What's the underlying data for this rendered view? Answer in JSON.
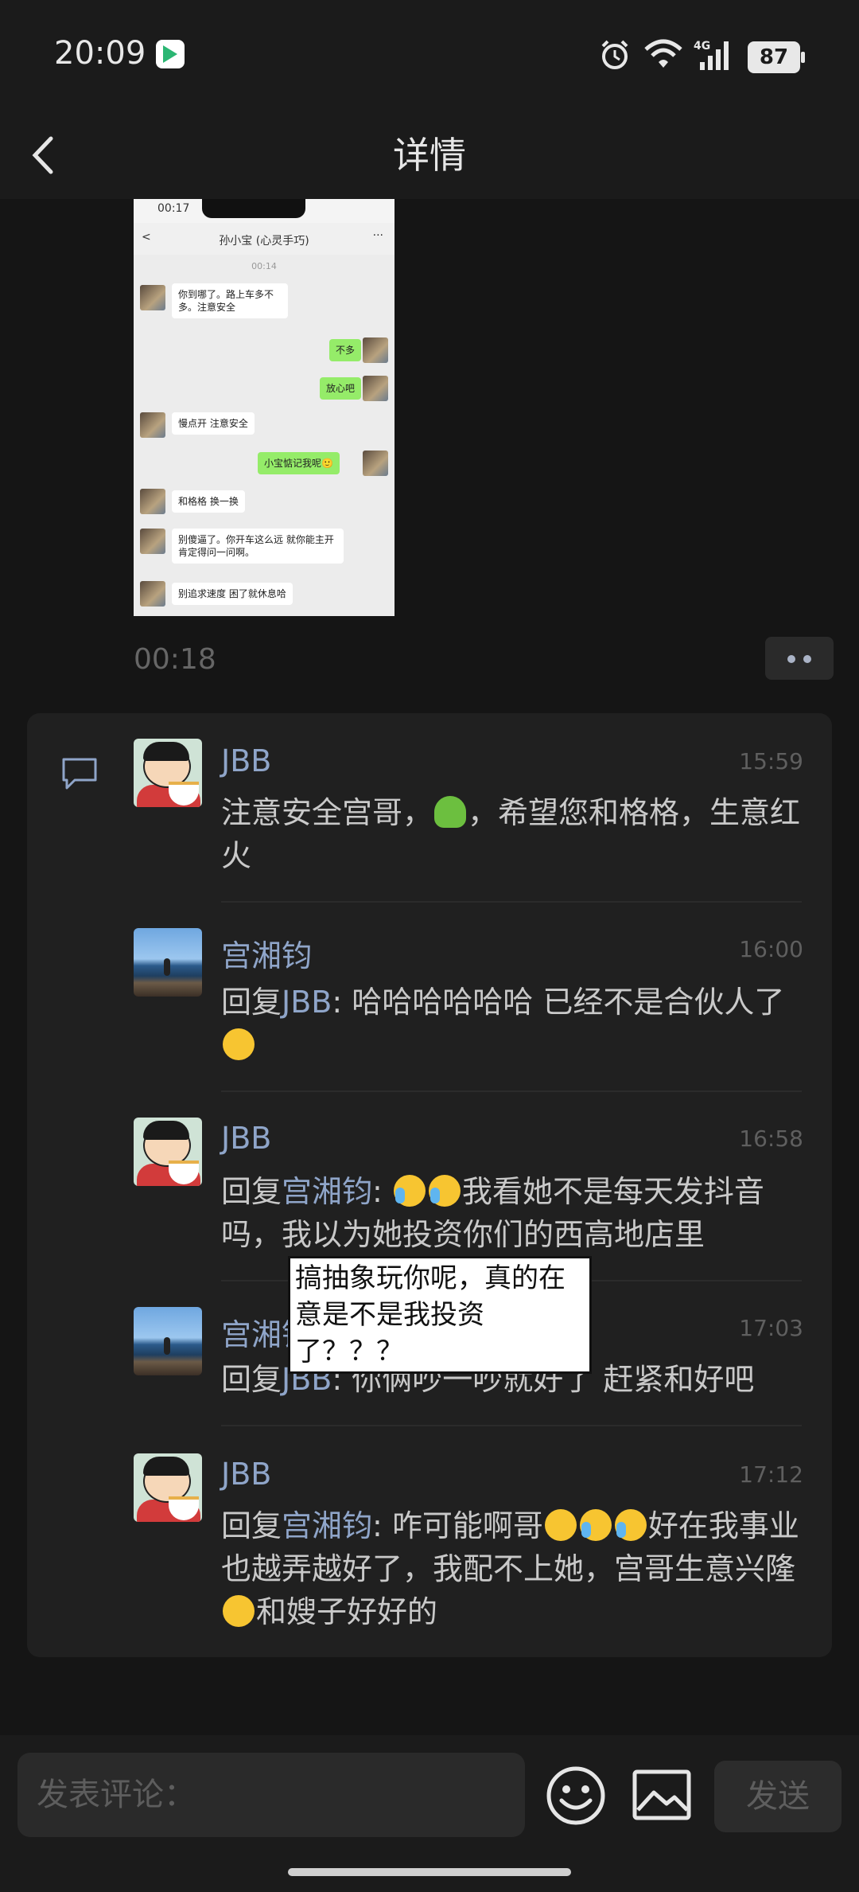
{
  "status_bar": {
    "time": "20:09",
    "battery": "87",
    "network": "4G"
  },
  "header": {
    "title": "详情"
  },
  "screenshot": {
    "time": "00:17",
    "title": "孙小宝 (心灵手巧)",
    "stamp": "00:14",
    "messages": [
      {
        "side": "left",
        "text": "你到哪了。路上车多不多。注意安全"
      },
      {
        "side": "right",
        "text": "不多"
      },
      {
        "side": "right",
        "text": "放心吧"
      },
      {
        "side": "left",
        "text": "慢点开 注意安全"
      },
      {
        "side": "right",
        "text": "小宝惦记我呢🙂"
      },
      {
        "side": "left",
        "text": "和格格 换一换"
      },
      {
        "side": "left",
        "text": "别傻逼了。你开车这么远 就你能主开肯定得问一问啊。"
      },
      {
        "side": "left",
        "text": "别追求速度 困了就休息哈"
      }
    ]
  },
  "post_time": "00:18",
  "comments": [
    {
      "name": "JBB",
      "time": "15:59",
      "avatar": "shinchan",
      "text_a": "注意安全宫哥，",
      "text_b": "，希望您和格格，生意红火"
    },
    {
      "name": "宫湘钧",
      "time": "16:00",
      "avatar": "sea",
      "reply_prefix": "回复",
      "reply_to": "JBB",
      "text": ": 哈哈哈哈哈哈 已经不是合伙人了"
    },
    {
      "name": "JBB",
      "time": "16:58",
      "avatar": "shinchan",
      "reply_prefix": "回复",
      "reply_to": "宫湘钧",
      "text": "我看她不是每天发抖音吗，我以为她投资你们的西高地店里"
    },
    {
      "name": "宫湘钧",
      "time": "17:03",
      "avatar": "sea",
      "reply_prefix": "回复",
      "reply_to": "JBB",
      "text": ": 你俩吵一吵就好了 赶紧和好吧"
    },
    {
      "name": "JBB",
      "time": "17:12",
      "avatar": "shinchan",
      "reply_prefix": "回复",
      "reply_to": "宫湘钧",
      "text_a": ": 咋可能啊哥",
      "text_b": "好在我事业也越弄越好了，我配不上她，宫哥生意兴隆",
      "text_c": "和嫂子好好的"
    }
  ],
  "sticker_text": "搞抽象玩你呢，真的在意是不是我投资了？？？",
  "input": {
    "placeholder": "发表评论：",
    "send": "发送"
  },
  "icons": [
    "back-icon",
    "comment-icon",
    "emoji-icon",
    "image-icon",
    "more-icon",
    "wifi-icon",
    "alarm-icon",
    "signal-icon"
  ]
}
